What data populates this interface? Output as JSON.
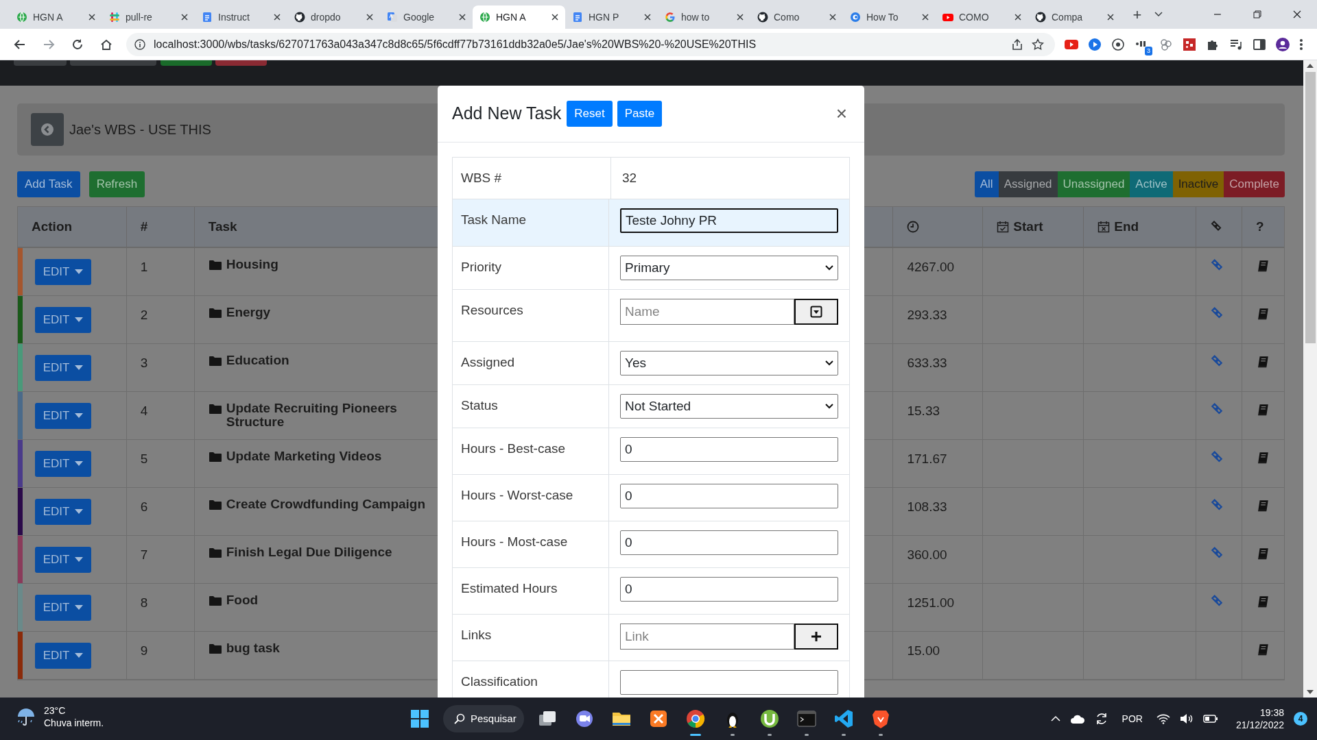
{
  "browser": {
    "tabs": [
      {
        "kind": "app",
        "title": "HGN A",
        "selected": false
      },
      {
        "kind": "hash",
        "title": "pull-re",
        "selected": false
      },
      {
        "kind": "doc",
        "title": "Instruct",
        "selected": false
      },
      {
        "kind": "github",
        "title": "dropdo",
        "selected": false
      },
      {
        "kind": "translate",
        "title": "Google",
        "selected": false
      },
      {
        "kind": "app",
        "title": "HGN A",
        "selected": true
      },
      {
        "kind": "doc",
        "title": "HGN P",
        "selected": false
      },
      {
        "kind": "google",
        "title": "how to",
        "selected": false
      },
      {
        "kind": "github",
        "title": "Como",
        "selected": false
      },
      {
        "kind": "swirl",
        "title": "How To",
        "selected": false
      },
      {
        "kind": "youtube",
        "title": "COMO",
        "selected": false
      },
      {
        "kind": "github",
        "title": "Compa",
        "selected": false
      }
    ],
    "new_tab": "+",
    "url": "localhost:3000/wbs/tasks/627071763a043a347c8d8c65/5f6cdff77b73161ddb32a0e5/Jae's%20WBS%20-%20USE%20THIS",
    "extensions": [
      {
        "kind": "youtube"
      },
      {
        "kind": "play"
      },
      {
        "kind": "ring"
      },
      {
        "kind": "git",
        "badge": "3"
      },
      {
        "kind": "cluster"
      },
      {
        "kind": "pixel"
      },
      {
        "kind": "puzzle"
      },
      {
        "kind": "media"
      },
      {
        "kind": "sidebar"
      },
      {
        "kind": "profile"
      }
    ]
  },
  "page": {
    "title": "Jae's WBS - USE THIS",
    "actions": [
      {
        "label": "Add Task",
        "kind": "primary"
      },
      {
        "label": "Refresh",
        "kind": "success"
      }
    ],
    "filters": [
      {
        "label": "All",
        "kind": "primary"
      },
      {
        "label": "Assigned",
        "kind": "secondary"
      },
      {
        "label": "Unassigned",
        "kind": "success"
      },
      {
        "label": "Active",
        "kind": "info"
      },
      {
        "label": "Inactive",
        "kind": "warning"
      },
      {
        "label": "Complete",
        "kind": "danger"
      }
    ],
    "table": {
      "columns": [
        {
          "kind": "text",
          "label": "Action"
        },
        {
          "kind": "text",
          "label": "#"
        },
        {
          "kind": "text",
          "label": "Task"
        },
        {
          "kind": "clock"
        },
        {
          "kind": "start",
          "label": "Start"
        },
        {
          "kind": "end",
          "label": "End"
        },
        {
          "kind": "link"
        },
        {
          "kind": "text",
          "label": "?"
        }
      ],
      "rows": [
        {
          "color": "#a5562e",
          "action": "EDIT",
          "number": "1",
          "task": "Housing",
          "folder": true,
          "hours": "4267.00",
          "has_link": true
        },
        {
          "color": "#1a5a1a",
          "action": "EDIT",
          "number": "2",
          "task": "Energy",
          "folder": true,
          "hours": "293.33",
          "has_link": true
        },
        {
          "color": "#4a9a7a",
          "action": "EDIT",
          "number": "3",
          "task": "Education",
          "folder": true,
          "hours": "633.33",
          "has_link": true
        },
        {
          "color": "#4a6a8a",
          "action": "EDIT",
          "number": "4",
          "task": "Update Recruiting Pioneers Structure",
          "folder": true,
          "hours": "15.33",
          "has_link": true
        },
        {
          "color": "#4a3a8a",
          "action": "EDIT",
          "number": "5",
          "task": "Update Marketing Videos",
          "folder": true,
          "hours": "171.67",
          "has_link": true
        },
        {
          "color": "#2a0a4a",
          "action": "EDIT",
          "number": "6",
          "task": "Create Crowdfunding Campaign",
          "folder": true,
          "hours": "108.33",
          "has_link": true
        },
        {
          "color": "#8a3a5a",
          "action": "EDIT",
          "number": "7",
          "task": "Finish Legal Due Diligence",
          "folder": true,
          "hours": "360.00",
          "has_link": true
        },
        {
          "color": "#6a8a8a",
          "action": "EDIT",
          "number": "8",
          "task": "Food",
          "folder": true,
          "hours": "1251.00",
          "has_link": true
        },
        {
          "color": "#8a2a0a",
          "action": "EDIT",
          "number": "9",
          "task": "bug task",
          "folder": true,
          "hours": "15.00",
          "has_link": false
        }
      ]
    }
  },
  "modal": {
    "title": "Add New Task",
    "buttons": [
      "Reset",
      "Paste"
    ],
    "close": "×",
    "fields": [
      {
        "kind": "static",
        "label": "WBS #",
        "value": "32",
        "highlighted": false
      },
      {
        "kind": "text",
        "label": "Task Name",
        "value": "Teste Johny PR",
        "highlighted": true
      },
      {
        "kind": "select",
        "label": "Priority",
        "value": "Primary",
        "highlighted": false
      },
      {
        "kind": "picker",
        "label": "Resources",
        "placeholder": "Name",
        "highlighted": false
      },
      {
        "kind": "select",
        "label": "Assigned",
        "value": "Yes",
        "highlighted": false
      },
      {
        "kind": "select",
        "label": "Status",
        "value": "Not Started",
        "highlighted": false
      },
      {
        "kind": "text",
        "label": "Hours - Best-case",
        "value": "0",
        "highlighted": false
      },
      {
        "kind": "text",
        "label": "Hours - Worst-case",
        "value": "0",
        "highlighted": false
      },
      {
        "kind": "text",
        "label": "Hours - Most-case",
        "value": "0",
        "highlighted": false
      },
      {
        "kind": "text",
        "label": "Estimated Hours",
        "value": "0",
        "highlighted": false
      },
      {
        "kind": "adder",
        "label": "Links",
        "placeholder": "Link",
        "highlighted": false
      },
      {
        "kind": "text",
        "label": "Classification",
        "highlighted": false
      }
    ]
  },
  "taskbar": {
    "weather": {
      "temperature": "23°C",
      "condition": "Chuva interm."
    },
    "search": "Pesquisar",
    "apps": [
      {
        "kind": "taskview",
        "running": false,
        "selected": false
      },
      {
        "kind": "chat",
        "running": false,
        "selected": false
      },
      {
        "kind": "explorer",
        "running": false,
        "selected": false
      },
      {
        "kind": "xampp",
        "running": false,
        "selected": false
      },
      {
        "kind": "chrome",
        "running": true,
        "selected": true
      },
      {
        "kind": "penguin",
        "running": true,
        "selected": false
      },
      {
        "kind": "torrent",
        "running": true,
        "selected": false
      },
      {
        "kind": "terminal",
        "running": true,
        "selected": false
      },
      {
        "kind": "vscode",
        "running": true,
        "selected": false
      },
      {
        "kind": "brave",
        "running": true,
        "selected": false
      }
    ],
    "language": "POR",
    "time": "19:38",
    "date": "21/12/2022",
    "notifications": "4"
  }
}
